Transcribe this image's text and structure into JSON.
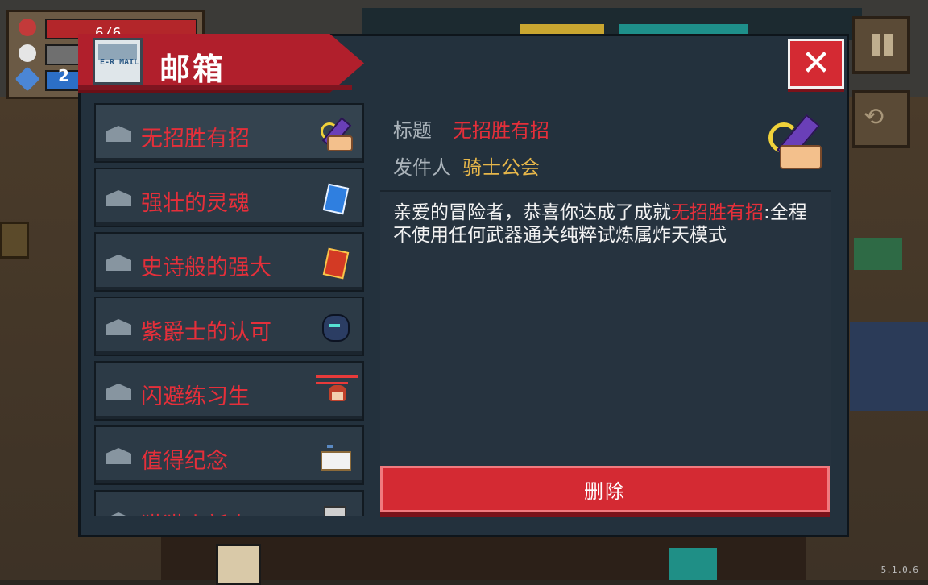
{
  "hud": {
    "hp": "6/6",
    "energy": "2"
  },
  "mailbox": {
    "title": "邮箱",
    "mail_icon_text": "E-R\nMAIL",
    "close_label": "✕",
    "items": [
      {
        "label": "无招胜有招",
        "thumb": "sword-hand-icon",
        "selected": true
      },
      {
        "label": "强壮的灵魂",
        "thumb": "blue-card-icon"
      },
      {
        "label": "史诗般的强大",
        "thumb": "red-card-icon"
      },
      {
        "label": "紫爵士的认可",
        "thumb": "dark-helm-icon"
      },
      {
        "label": "闪避练习生",
        "thumb": "dodge-character-icon"
      },
      {
        "label": "值得纪念",
        "thumb": "sign-board-icon"
      },
      {
        "label": "猫猫小新人",
        "thumb": "cat-icon"
      }
    ],
    "detail": {
      "title_label": "标题",
      "title_value": "无招胜有招",
      "sender_label": "发件人",
      "sender_value": "骑士公会",
      "body_prefix": "亲爱的冒险者，恭喜你达成了成就",
      "body_highlight": "无招胜有招",
      "body_suffix": ":全程不使用任何武器通关纯粹试炼属炸天模式",
      "delete_label": "删除"
    }
  },
  "version": "5.1.0.6",
  "colors": {
    "accent_red": "#d42a33",
    "label_red": "#e52f3a",
    "sender_gold": "#e7b74a",
    "panel_bg": "#23313d"
  }
}
